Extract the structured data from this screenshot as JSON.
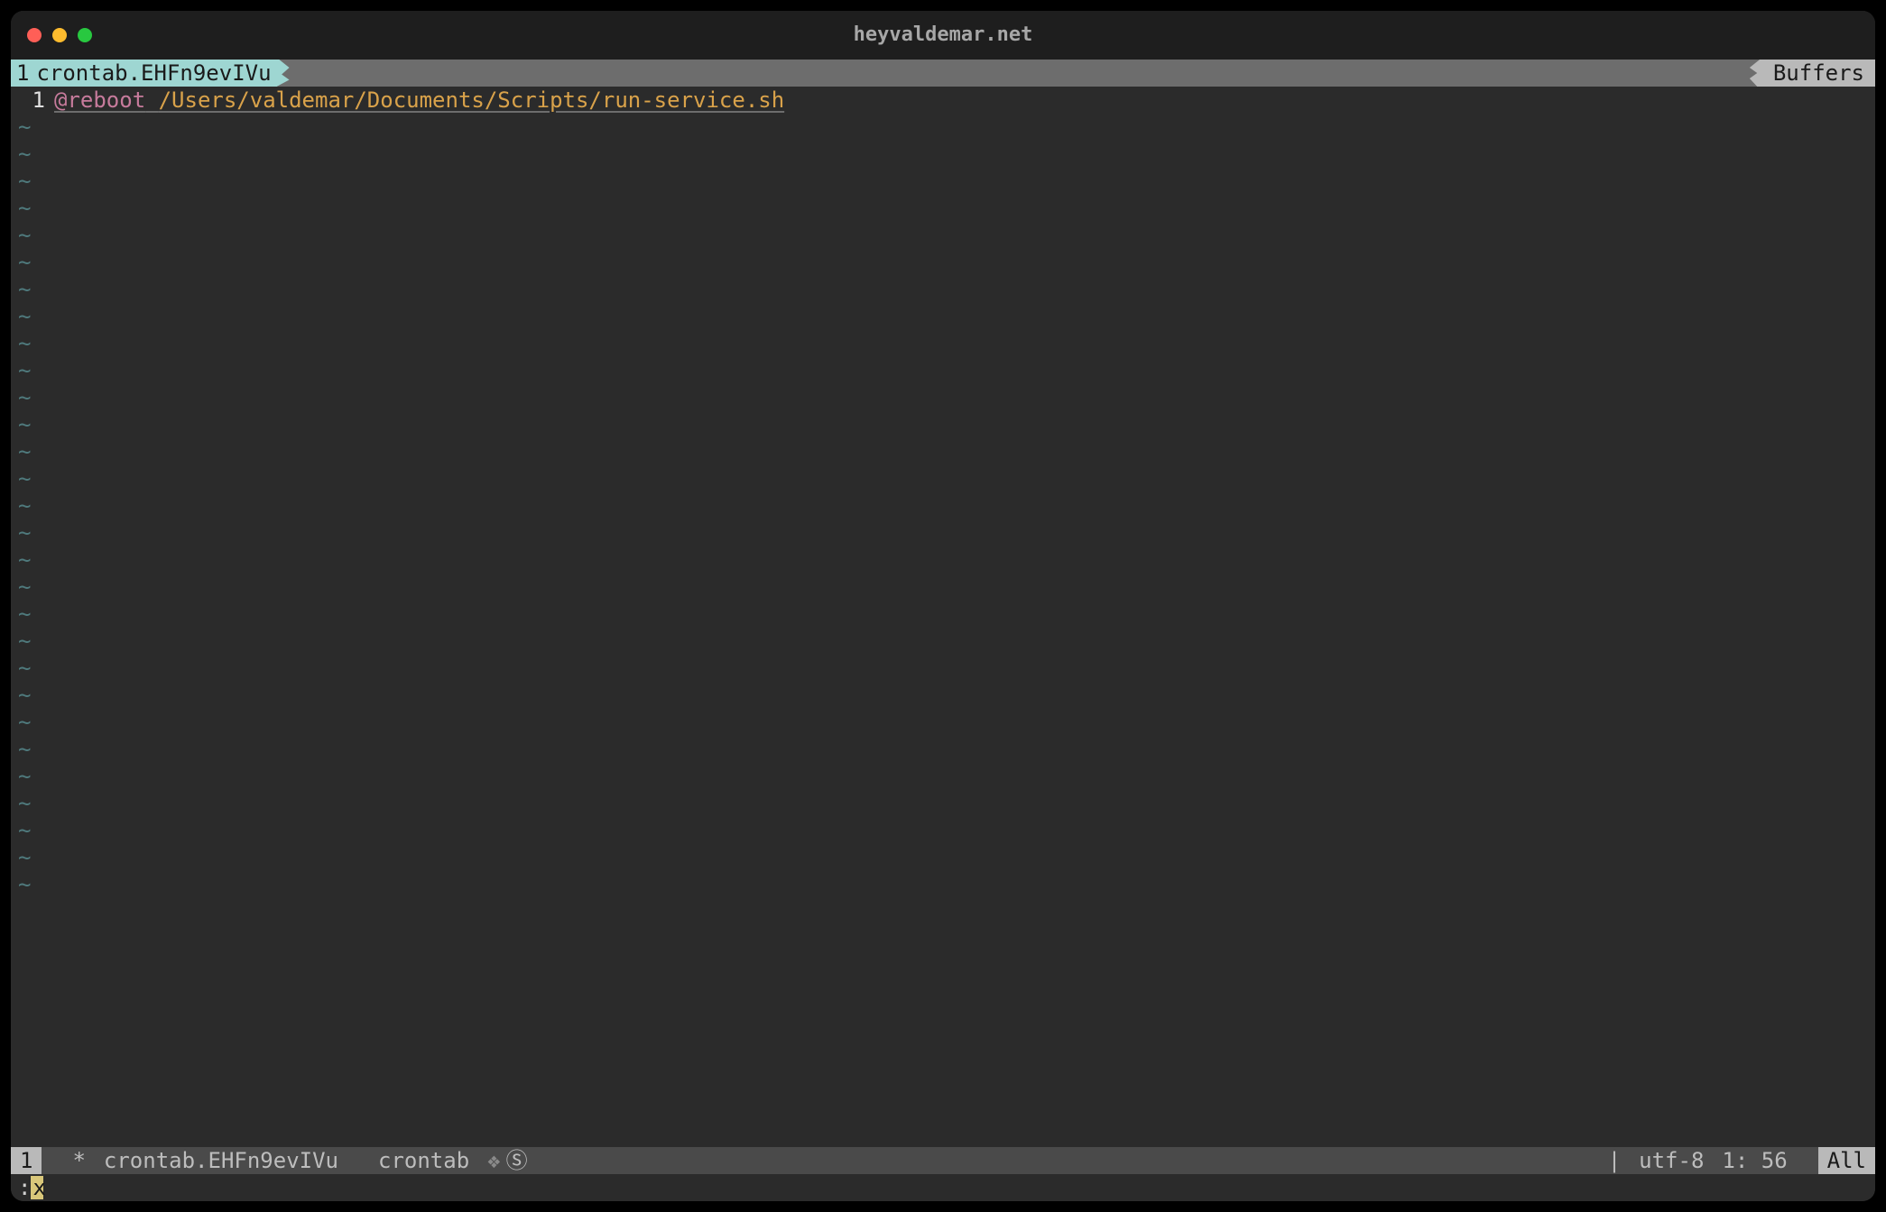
{
  "window": {
    "title": "heyvaldemar.net"
  },
  "tabline": {
    "active_index": "1",
    "active_name": "crontab.EHFn9evIVu",
    "buffers_label": "Buffers"
  },
  "editor": {
    "current_line_number": "1",
    "line1": {
      "keyword": "@reboot",
      "space": " ",
      "path": "/Users/valdemar/Documents/Scripts/run-service.sh"
    },
    "tilde": "~",
    "empty_line_count": 29
  },
  "statusline": {
    "win_number": "1",
    "modified": "*",
    "filename": "crontab.EHFn9evIVu",
    "filetype": "crontab",
    "diamond": "❖",
    "spell": "Ⓢ",
    "os_icon": "",
    "sep": "|",
    "encoding": "utf-8",
    "position": "1: 56",
    "percent": "All"
  },
  "cmdline": {
    "colon": ":",
    "text": "x"
  }
}
